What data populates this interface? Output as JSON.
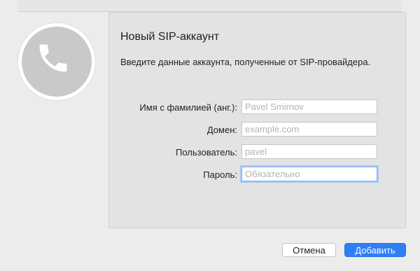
{
  "dialog": {
    "title": "Новый SIP-аккаунт",
    "subtitle": "Введите данные аккаунта, полученные от SIP-провайдера."
  },
  "fields": [
    {
      "label": "Имя с фамилией (анг.):",
      "placeholder": "Pavel Smirnov",
      "value": ""
    },
    {
      "label": "Домен:",
      "placeholder": "example.com",
      "value": ""
    },
    {
      "label": "Пользователь:",
      "placeholder": "pavel",
      "value": ""
    },
    {
      "label": "Пароль:",
      "placeholder": "Обязательно",
      "value": ""
    }
  ],
  "buttons": {
    "cancel": "Отмена",
    "add": "Добавить"
  },
  "icons": {
    "avatar": "phone-icon"
  },
  "colors": {
    "primary_button": "#2f7ef6",
    "focus_ring": "#a7c8f3"
  }
}
